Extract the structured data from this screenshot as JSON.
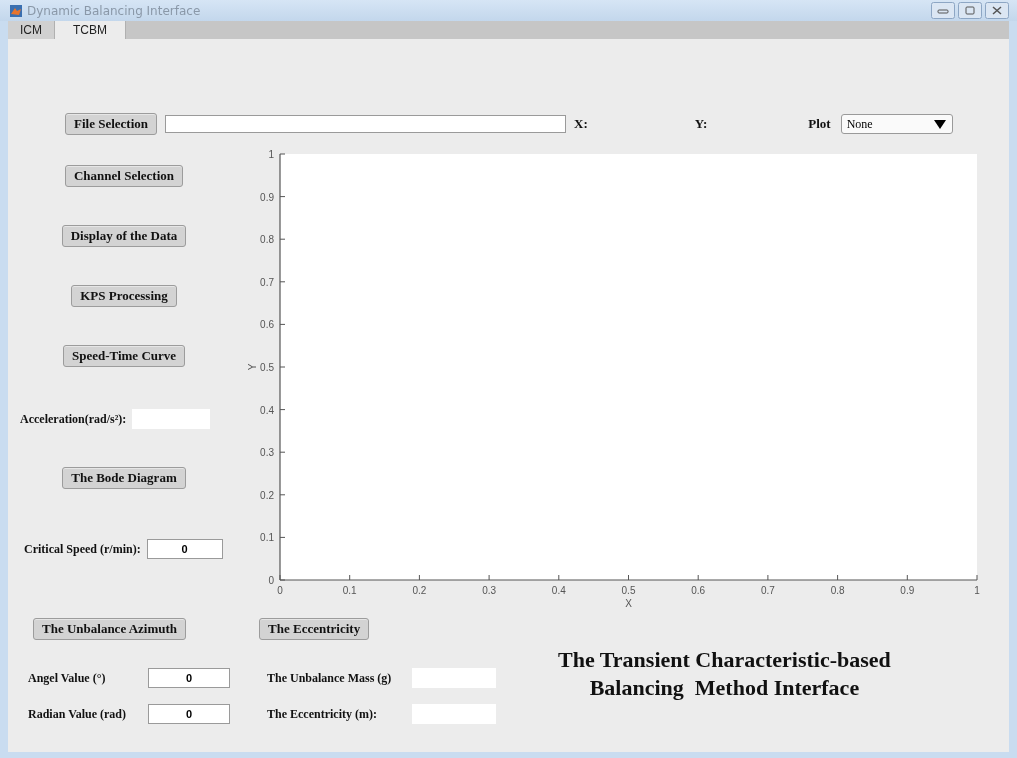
{
  "window": {
    "title": "Dynamic Balancing Interface"
  },
  "tabs": [
    {
      "label": "ICM",
      "selected": false
    },
    {
      "label": "TCBM",
      "selected": true
    }
  ],
  "file_selection": {
    "button": "File Selection",
    "x_label": "X:",
    "y_label": "Y:"
  },
  "plot_select": {
    "label": "Plot",
    "value": "None"
  },
  "left_buttons": [
    "Channel Selection",
    "Display of the Data",
    "KPS Processing",
    "Speed-Time Curve"
  ],
  "acceleration": {
    "label": "Acceleration(rad/s²):"
  },
  "bode_button": "The Bode Diagram",
  "critical_speed": {
    "label": "Critical Speed (r/min):",
    "value": "0"
  },
  "chart_data": {
    "type": "line",
    "xlabel": "X",
    "ylabel": "Y",
    "xlim": [
      0,
      1
    ],
    "ylim": [
      0,
      1
    ],
    "xticks": [
      {
        "value": 0,
        "label": "0"
      },
      {
        "value": 0.1,
        "label": "0.1"
      },
      {
        "value": 0.2,
        "label": "0.2"
      },
      {
        "value": 0.3,
        "label": "0.3"
      },
      {
        "value": 0.4,
        "label": "0.4"
      },
      {
        "value": 0.5,
        "label": "0.5"
      },
      {
        "value": 0.6,
        "label": "0.6"
      },
      {
        "value": 0.7,
        "label": "0.7"
      },
      {
        "value": 0.8,
        "label": "0.8"
      },
      {
        "value": 0.9,
        "label": "0.9"
      },
      {
        "value": 1,
        "label": "1"
      }
    ],
    "yticks": [
      {
        "value": 0,
        "label": "0"
      },
      {
        "value": 0.1,
        "label": "0.1"
      },
      {
        "value": 0.2,
        "label": "0.2"
      },
      {
        "value": 0.3,
        "label": "0.3"
      },
      {
        "value": 0.4,
        "label": "0.4"
      },
      {
        "value": 0.5,
        "label": "0.5"
      },
      {
        "value": 0.6,
        "label": "0.6"
      },
      {
        "value": 0.7,
        "label": "0.7"
      },
      {
        "value": 0.8,
        "label": "0.8"
      },
      {
        "value": 0.9,
        "label": "0.9"
      },
      {
        "value": 1,
        "label": "1"
      }
    ]
  },
  "azimuth_button": "The Unbalance Azimuth",
  "eccentricity_button": "The Eccentricity",
  "left_fields": [
    {
      "label": "Angel Value (°)",
      "value": "0"
    },
    {
      "label": "Radian Value (rad)",
      "value": "0"
    }
  ],
  "right_fields": [
    {
      "label": "The Unbalance Mass (g)"
    },
    {
      "label": "The Eccentricity (m):"
    }
  ],
  "title_lines": [
    "The Transient Characteristic-based",
    "Balancing  Method Interface"
  ]
}
